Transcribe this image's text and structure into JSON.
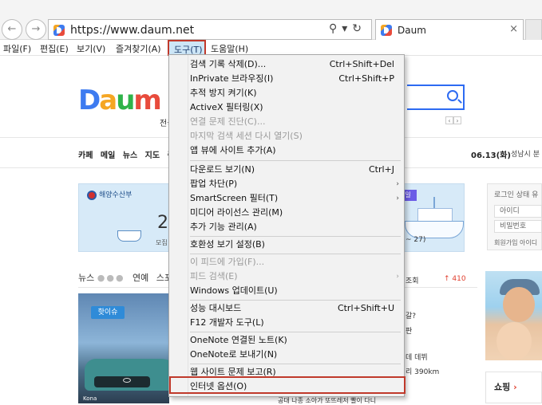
{
  "browser": {
    "url": "https://www.daum.net",
    "tab_title": "Daum",
    "tab_close": "×"
  },
  "menubar": {
    "items": [
      "파일(F)",
      "편집(E)",
      "보기(V)",
      "즐겨찾기(A)",
      "도구(T)",
      "도움말(H)"
    ],
    "active_index": 4
  },
  "tools_menu": {
    "items": [
      {
        "label": "검색 기록 삭제(D)...",
        "shortcut": "Ctrl+Shift+Del",
        "enabled": true
      },
      {
        "label": "InPrivate 브라우징(I)",
        "shortcut": "Ctrl+Shift+P",
        "enabled": true
      },
      {
        "label": "추적 방지 켜기(K)",
        "shortcut": "",
        "enabled": true
      },
      {
        "label": "ActiveX 필터링(X)",
        "shortcut": "",
        "enabled": true
      },
      {
        "label": "연결 문제 진단(C)...",
        "shortcut": "",
        "enabled": false
      },
      {
        "label": "마지막 검색 세션 다시 열기(S)",
        "shortcut": "",
        "enabled": false
      },
      {
        "label": "앱 뷰에 사이트 추가(A)",
        "shortcut": "",
        "enabled": true
      },
      {
        "label": "다운로드 보기(N)",
        "shortcut": "Ctrl+J",
        "enabled": true
      },
      {
        "label": "팝업 차단(P)",
        "shortcut": "",
        "submenu": true,
        "enabled": true
      },
      {
        "label": "SmartScreen 필터(T)",
        "shortcut": "",
        "submenu": true,
        "enabled": true
      },
      {
        "label": "미디어 라이선스 관리(M)",
        "shortcut": "",
        "enabled": true
      },
      {
        "label": "추가 기능 관리(A)",
        "shortcut": "",
        "enabled": true
      },
      {
        "label": "호환성 보기 설정(B)",
        "shortcut": "",
        "enabled": true
      },
      {
        "label": "이 피드에 가입(F)...",
        "shortcut": "",
        "enabled": false
      },
      {
        "label": "피드 검색(E)",
        "shortcut": "",
        "submenu": true,
        "enabled": false
      },
      {
        "label": "Windows 업데이트(U)",
        "shortcut": "",
        "enabled": true
      },
      {
        "label": "성능 대시보드",
        "shortcut": "Ctrl+Shift+U",
        "enabled": true
      },
      {
        "label": "F12 개발자 도구(L)",
        "shortcut": "",
        "enabled": true
      },
      {
        "label": "OneNote 연결된 노트(K)",
        "shortcut": "",
        "enabled": true
      },
      {
        "label": "OneNote로 보내기(N)",
        "shortcut": "",
        "enabled": true
      },
      {
        "label": "웹 사이트 문제 보고(R)",
        "shortcut": "",
        "enabled": true
      },
      {
        "label": "인터넷 옵션(O)",
        "shortcut": "",
        "enabled": true,
        "highlighted": true
      }
    ],
    "submenu_glyph": "›"
  },
  "page": {
    "logo": "Daum",
    "search_prefix_partial": "전국",
    "categories": [
      "카페",
      "메일",
      "뉴스",
      "지도",
      "증"
    ],
    "date": "06.13(화)",
    "location": "성남시 분",
    "banner": {
      "ministry": "해양수산부",
      "big_number": "2",
      "small_text": "모집",
      "badge": "일",
      "date_text": "~ 27)"
    },
    "login": {
      "keep_login": "로그인 상태 유",
      "id_placeholder": "아이디",
      "pw_placeholder": "비밀번호",
      "links": "회원가입  아이디"
    },
    "news": {
      "tab_news": "뉴스",
      "dots": "●●●",
      "tab_entertainment": "연예",
      "tab_sports_partial": "스포",
      "hot_badge": "핫이슈",
      "car_text": "Kona",
      "ranking_label": "조회",
      "ranking_delta": "↑ 410",
      "right_snippets": [
        "갈?",
        "판",
        "데 데뷔",
        "리 390km",
        "공대 나종 소아가 또뜨레저 빨이 다니"
      ]
    },
    "shopping": {
      "label": "쇼핑",
      "arrow": "›"
    }
  },
  "colors": {
    "accent_red": "#c0392b",
    "menu_hover": "#cde6f7",
    "daum_blue": "#2d6bf2"
  }
}
